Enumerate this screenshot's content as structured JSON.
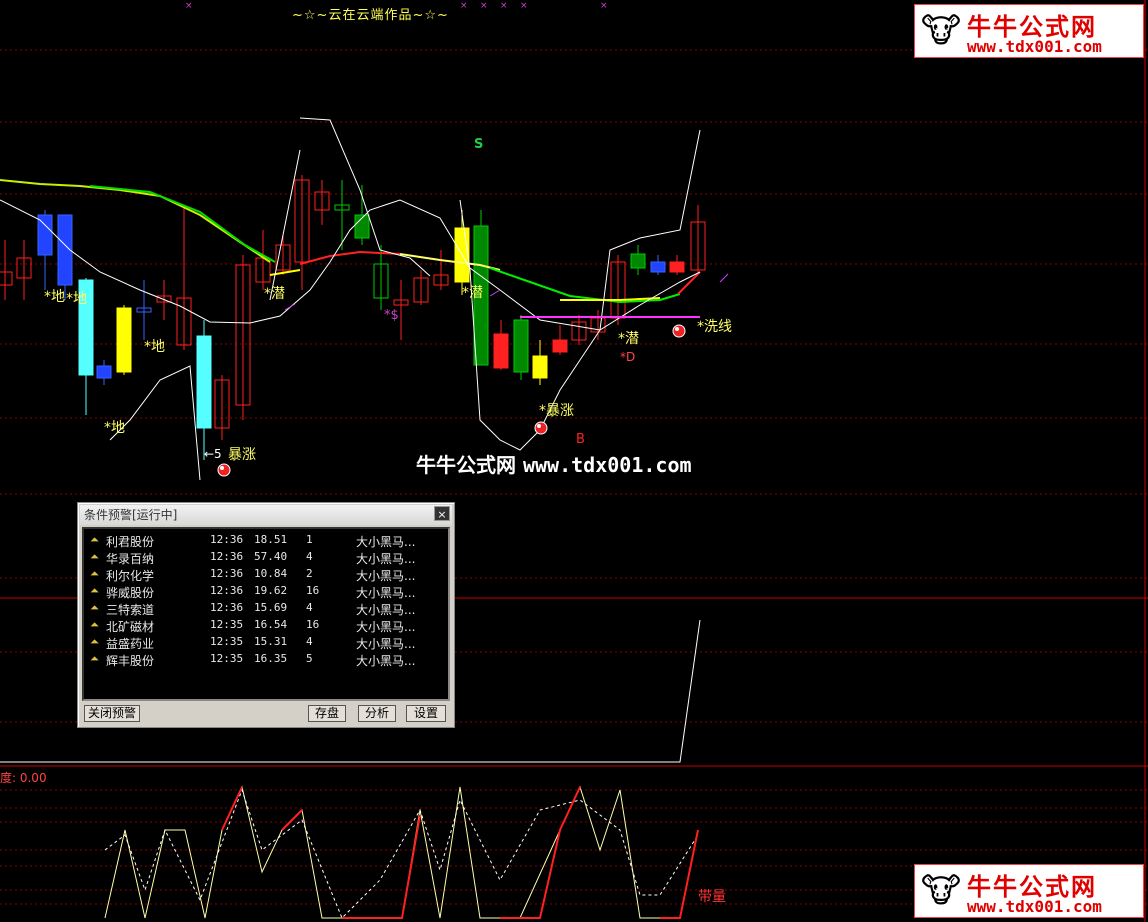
{
  "chart_title": "~☆~云在云端作品~☆~",
  "logo": {
    "cn": "牛牛公式网",
    "url": "www.tdx001.com"
  },
  "watermark": {
    "cn": "牛牛公式网",
    "url": "www.tdx001.com"
  },
  "chart_labels": [
    {
      "text": "S",
      "color": "#22cc44"
    },
    {
      "text": "*地"
    },
    {
      "text": "*地"
    },
    {
      "text": "*地"
    },
    {
      "text": "*地"
    },
    {
      "text": "*潜"
    },
    {
      "text": "*潜"
    },
    {
      "text": "*潜"
    },
    {
      "text": "*洗线"
    },
    {
      "text": "*暴涨"
    },
    {
      "text": "暴涨"
    },
    {
      "text": "*D",
      "color": "#ff4444"
    },
    {
      "text": "B",
      "color": "#ff2222"
    },
    {
      "text": "*$",
      "color": "#cc44cc"
    },
    {
      "text": "←5",
      "color": "#ffffff"
    }
  ],
  "indicator_label": "度: 0.00",
  "volume_label": "带量",
  "alert": {
    "title": "条件预警[运行中]",
    "close": "×",
    "rows": [
      {
        "name": "利君股份",
        "time": "12:36",
        "price": "18.51",
        "count": "1",
        "cond": "大小黑马..."
      },
      {
        "name": "华录百纳",
        "time": "12:36",
        "price": "57.40",
        "count": "4",
        "cond": "大小黑马..."
      },
      {
        "name": "利尔化学",
        "time": "12:36",
        "price": "10.84",
        "count": "2",
        "cond": "大小黑马..."
      },
      {
        "name": "骅威股份",
        "time": "12:36",
        "price": "19.62",
        "count": "16",
        "cond": "大小黑马..."
      },
      {
        "name": "三特索道",
        "time": "12:36",
        "price": "15.69",
        "count": "4",
        "cond": "大小黑马..."
      },
      {
        "name": "北矿磁材",
        "time": "12:35",
        "price": "16.54",
        "count": "16",
        "cond": "大小黑马..."
      },
      {
        "name": "益盛药业",
        "time": "12:35",
        "price": "15.31",
        "count": "4",
        "cond": "大小黑马..."
      },
      {
        "name": "辉丰股份",
        "time": "12:35",
        "price": "16.35",
        "count": "5",
        "cond": "大小黑马..."
      }
    ],
    "buttons": {
      "close_alert": "关闭预警",
      "save": "存盘",
      "analyze": "分析",
      "settings": "设置"
    }
  },
  "colors": {
    "up": "#ff2020",
    "down_fill": "#00ff00",
    "yellow": "#ffff00",
    "cyan": "#55ffff",
    "grid": "#8b0000"
  }
}
